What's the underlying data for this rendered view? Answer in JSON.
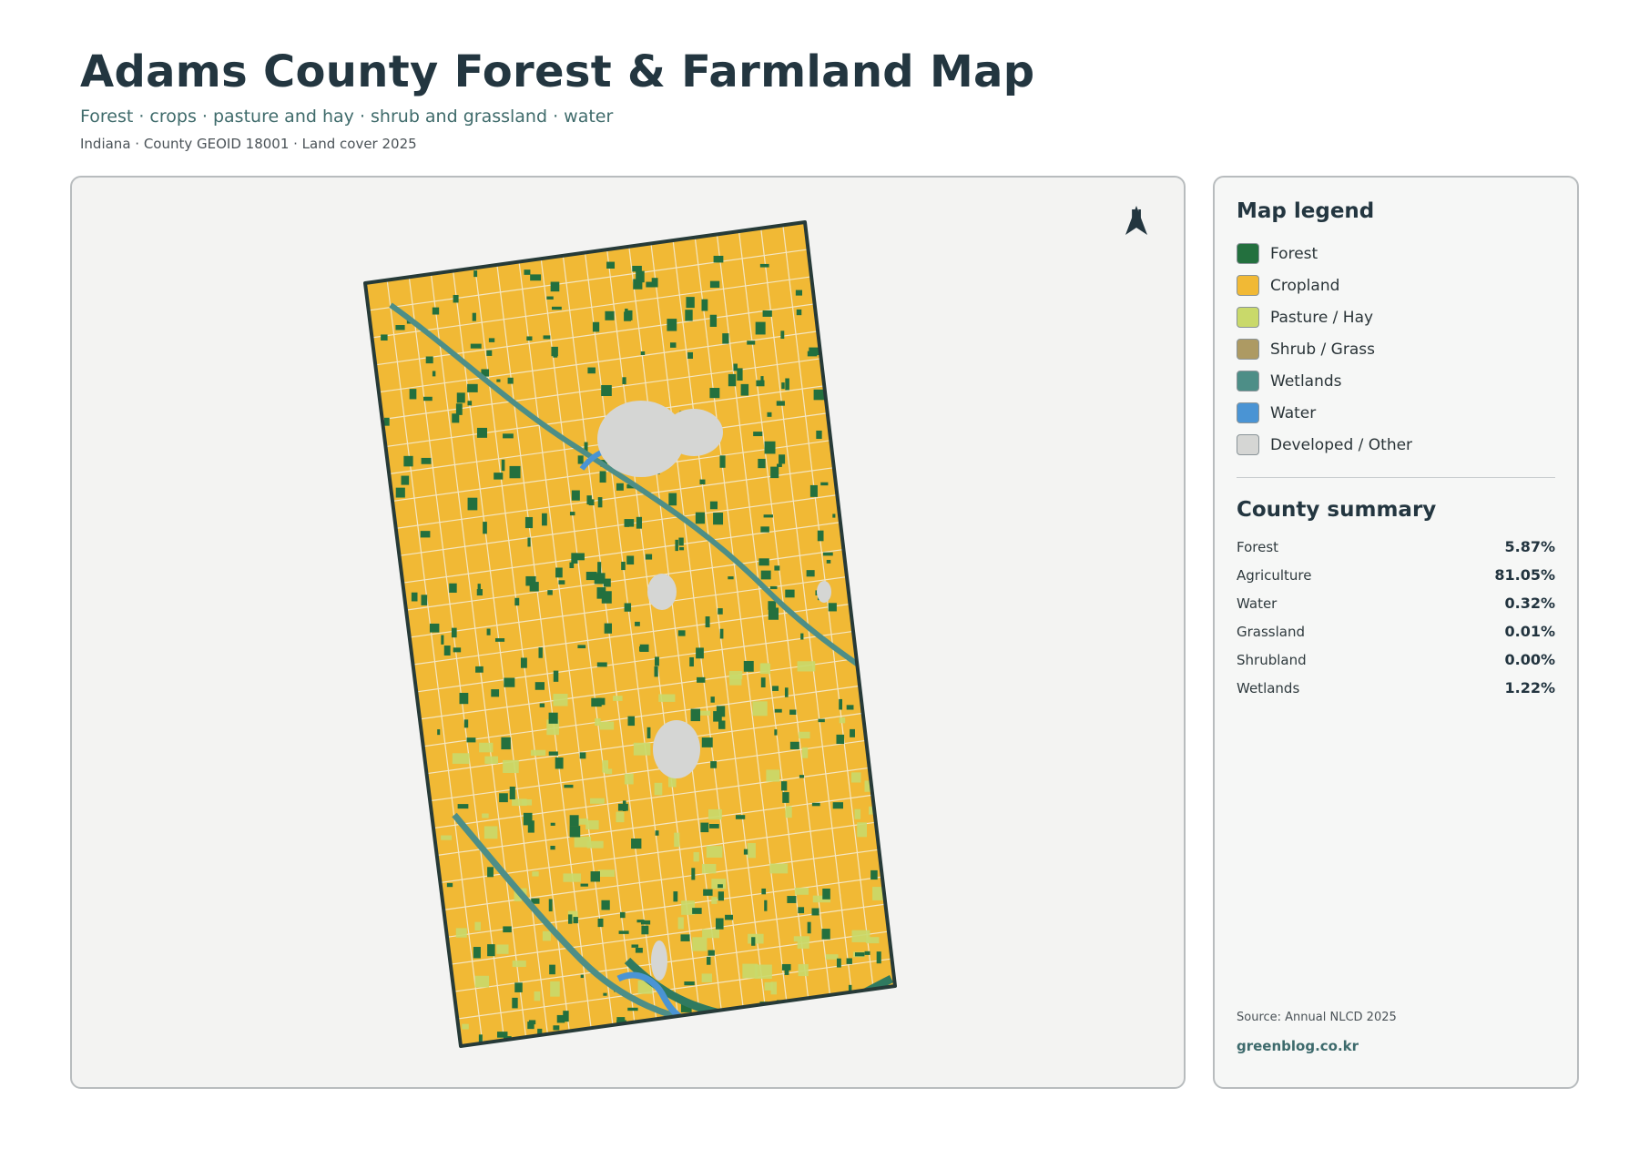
{
  "header": {
    "title": "Adams County Forest & Farmland Map",
    "subtitle": "Forest · crops · pasture and hay · shrub and grassland · water",
    "meta": "Indiana · County GEOID 18001 · Land cover 2025"
  },
  "map": {
    "north_label": "N"
  },
  "legend": {
    "title": "Map legend",
    "items": [
      {
        "label": "Forest",
        "color": "#23703e"
      },
      {
        "label": "Cropland",
        "color": "#f1b935"
      },
      {
        "label": "Pasture / Hay",
        "color": "#c9d96a"
      },
      {
        "label": "Shrub / Grass",
        "color": "#ad9a63"
      },
      {
        "label": "Wetlands",
        "color": "#4d8e87"
      },
      {
        "label": "Water",
        "color": "#4a94d4"
      },
      {
        "label": "Developed / Other",
        "color": "#d5d6d4"
      }
    ]
  },
  "summary": {
    "title": "County summary",
    "rows": [
      {
        "label": "Forest",
        "value": "5.87%"
      },
      {
        "label": "Agriculture",
        "value": "81.05%"
      },
      {
        "label": "Water",
        "value": "0.32%"
      },
      {
        "label": "Grassland",
        "value": "0.01%"
      },
      {
        "label": "Shrubland",
        "value": "0.00%"
      },
      {
        "label": "Wetlands",
        "value": "1.22%"
      }
    ]
  },
  "footer": {
    "source": "Source: Annual NLCD 2025",
    "website": "greenblog.co.kr"
  }
}
